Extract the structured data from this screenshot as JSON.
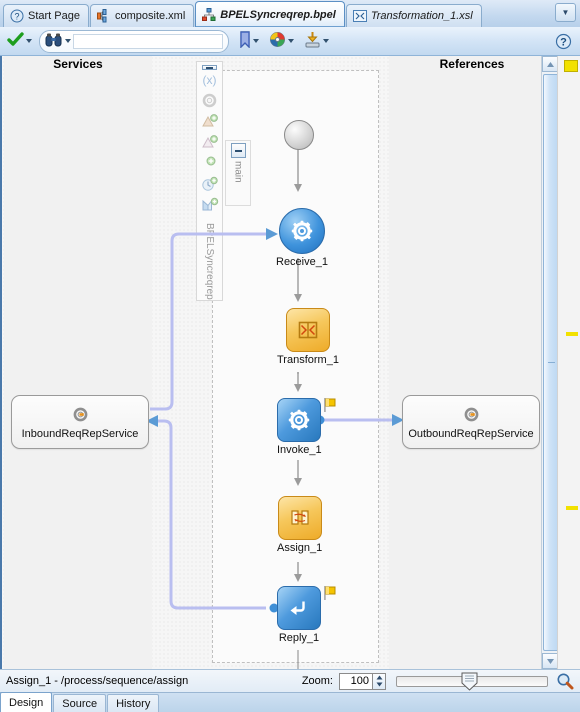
{
  "window": {
    "tabs": [
      {
        "label": "Start Page",
        "icon": "question-mark-icon",
        "active": false,
        "italic": false
      },
      {
        "label": "composite.xml",
        "icon": "composite-icon",
        "active": false,
        "italic": false
      },
      {
        "label": "BPELSyncreqrep.bpel",
        "icon": "bpel-icon",
        "active": true,
        "italic": true
      },
      {
        "label": "Transformation_1.xsl",
        "icon": "xsl-icon",
        "active": false,
        "italic": true
      }
    ],
    "tab_overflow_label": "▼"
  },
  "toolbar": {
    "validate_label": "validate-check",
    "search_placeholder": "",
    "search_value": "",
    "icons": [
      "check-icon",
      "binoculars-icon",
      "bookmark-icon",
      "palette-icon",
      "deploy-icon"
    ],
    "help_label": "?"
  },
  "canvas": {
    "lanes": {
      "services_header": "Services",
      "references_header": "References"
    },
    "palette": {
      "collapse_label": "−",
      "process_label": "BPELSyncreqrep",
      "icons": [
        "variables-icon",
        "gear-icon",
        "partnerlink-add-icon",
        "partnerlink-add-2-icon",
        "add-icon",
        "timer-add-icon",
        "flow-add-icon"
      ]
    },
    "main_scope": {
      "collapse_label": "−",
      "label": "main"
    },
    "nodes": [
      {
        "id": "start",
        "type": "start-terminal",
        "label": ""
      },
      {
        "id": "receive",
        "type": "receive-activity",
        "label": "Receive_1",
        "icon": "gear-icon"
      },
      {
        "id": "transform",
        "type": "transform-activity",
        "label": "Transform_1",
        "icon": "transform-icon"
      },
      {
        "id": "invoke",
        "type": "invoke-activity",
        "label": "Invoke_1",
        "icon": "gear-icon",
        "flag": true
      },
      {
        "id": "assign",
        "type": "assign-activity",
        "label": "Assign_1",
        "icon": "assign-icon"
      },
      {
        "id": "reply",
        "type": "reply-activity",
        "label": "Reply_1",
        "icon": "reply-arrow-icon",
        "flag": true
      },
      {
        "id": "end",
        "type": "end-terminal",
        "label": ""
      }
    ],
    "services": [
      {
        "id": "inbound",
        "name": "InboundReqRepService",
        "icon": "gear-icon",
        "side": "left"
      },
      {
        "id": "outbound",
        "name": "OutboundReqRepService",
        "icon": "gear-icon",
        "side": "right"
      }
    ]
  },
  "status": {
    "path": "Assign_1 - /process/sequence/assign",
    "zoom_label": "Zoom:",
    "zoom_value": "100",
    "zoom_up": "▲",
    "zoom_down": "▼",
    "magnifier_icon": "magnifier-icon"
  },
  "bottom_tabs": [
    {
      "label": "Design",
      "active": true
    },
    {
      "label": "Source",
      "active": false
    },
    {
      "label": "History",
      "active": false
    }
  ],
  "colors": {
    "accent_blue": "#2878bd",
    "activity_orange": "#eeab29",
    "connector_lavender": "#b9bef0",
    "flag_yellow": "#f2c100",
    "overview_mark": "#f2e100"
  }
}
